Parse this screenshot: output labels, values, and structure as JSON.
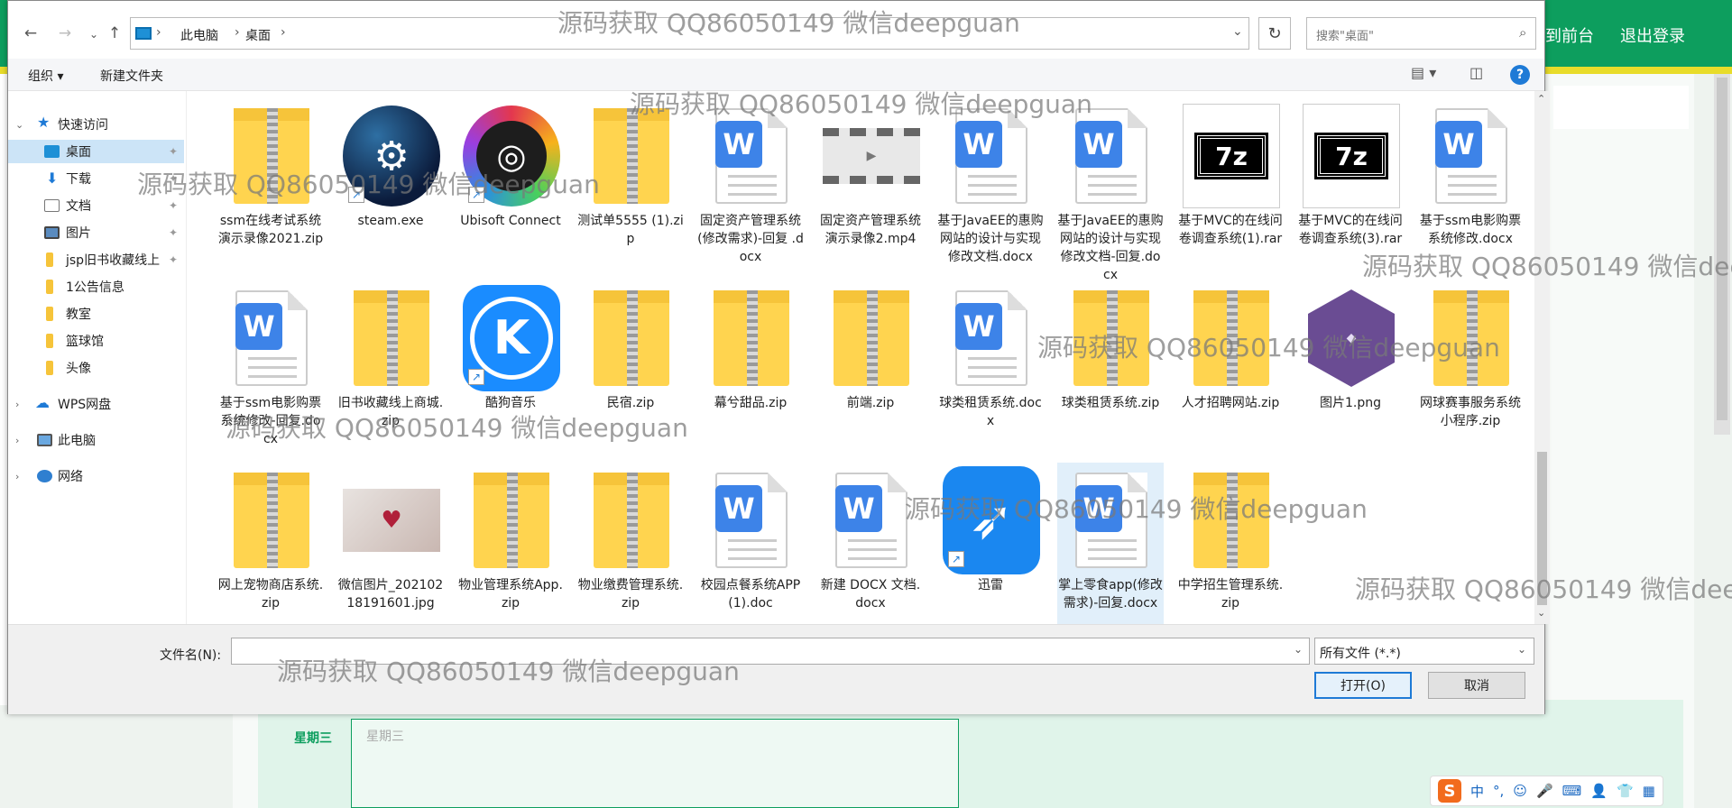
{
  "background": {
    "top_links": [
      "到前台",
      "退出登录"
    ],
    "day_label": "星期三",
    "day_placeholder": "星期三",
    "ime": {
      "logo": "S",
      "items": [
        "中",
        "°,",
        "☺",
        "🎤",
        "⌨",
        "👤",
        "👕",
        "▦"
      ]
    }
  },
  "dialog": {
    "breadcrumb": [
      "此电脑",
      "桌面"
    ],
    "search_placeholder": "搜索\"桌面\"",
    "toolbar": {
      "organize": "组织 ▾",
      "new_folder": "新建文件夹"
    },
    "nav": [
      {
        "label": "快速访问",
        "icon": "star-icon"
      },
      {
        "label": "桌面",
        "icon": "desktop-icon",
        "selected": true,
        "pinned": true
      },
      {
        "label": "下载",
        "icon": "download-icon",
        "pinned": true
      },
      {
        "label": "文档",
        "icon": "document-icon",
        "pinned": true
      },
      {
        "label": "图片",
        "icon": "picture-icon",
        "pinned": true
      },
      {
        "label": "jsp旧书收藏线上",
        "icon": "folder-icon",
        "pinned": true
      },
      {
        "label": "1公告信息",
        "icon": "folder-icon"
      },
      {
        "label": "教室",
        "icon": "folder-icon"
      },
      {
        "label": "篮球馆",
        "icon": "folder-icon"
      },
      {
        "label": "头像",
        "icon": "folder-icon"
      },
      {
        "label": "WPS网盘",
        "icon": "cloud-icon"
      },
      {
        "label": "此电脑",
        "icon": "computer-icon"
      },
      {
        "label": "网络",
        "icon": "network-icon"
      }
    ],
    "files": [
      {
        "name": "ssm在线考试系统演示录像2021.zip",
        "type": "zip"
      },
      {
        "name": "steam.exe",
        "type": "steam"
      },
      {
        "name": "Ubisoft Connect",
        "type": "ubisoft"
      },
      {
        "name": "测试单5555 (1).zip",
        "type": "zip"
      },
      {
        "name": "固定资产管理系统(修改需求)-回复 .docx",
        "type": "docx"
      },
      {
        "name": "固定资产管理系统演示录像2.mp4",
        "type": "video"
      },
      {
        "name": "基于JavaEE的惠购网站的设计与实现修改文档.docx",
        "type": "docx"
      },
      {
        "name": "基于JavaEE的惠购网站的设计与实现修改文档-回复.docx",
        "type": "docx"
      },
      {
        "name": "基于MVC的在线问卷调查系统(1).rar",
        "type": "rar"
      },
      {
        "name": "基于MVC的在线问卷调查系统(3).rar",
        "type": "rar"
      },
      {
        "name": "基于ssm电影购票系统修改.docx",
        "type": "docx"
      },
      {
        "name": "基于ssm电影购票系统修改-回复.docx",
        "type": "docx"
      },
      {
        "name": "旧书收藏线上商城.zip",
        "type": "zip"
      },
      {
        "name": "酷狗音乐",
        "type": "kugou"
      },
      {
        "name": "民宿.zip",
        "type": "zip"
      },
      {
        "name": "幕兮甜品.zip",
        "type": "zip"
      },
      {
        "name": "前端.zip",
        "type": "zip"
      },
      {
        "name": "球类租赁系统.docx",
        "type": "docx"
      },
      {
        "name": "球类租赁系统.zip",
        "type": "zip"
      },
      {
        "name": "人才招聘网站.zip",
        "type": "zip"
      },
      {
        "name": "图片1.png",
        "type": "png"
      },
      {
        "name": "网球赛事服务系统小程序.zip",
        "type": "zip"
      },
      {
        "name": "网上宠物商店系统.zip",
        "type": "zip"
      },
      {
        "name": "微信图片_20210218191601.jpg",
        "type": "jpg"
      },
      {
        "name": "物业管理系统App.zip",
        "type": "zip"
      },
      {
        "name": "物业缴费管理系统.zip",
        "type": "zip"
      },
      {
        "name": "校园点餐系统APP (1).doc",
        "type": "docx"
      },
      {
        "name": "新建 DOCX 文档.docx",
        "type": "docx"
      },
      {
        "name": "迅雷",
        "type": "xunlei"
      },
      {
        "name": "掌上零食app(修改需求)-回复.docx",
        "type": "docx",
        "selected": true
      },
      {
        "name": "中学招生管理系统.zip",
        "type": "zip"
      }
    ],
    "filename_label": "文件名(N):",
    "filename_value": "",
    "filetype": "所有文件 (*.*)",
    "open_button": "打开(O)",
    "cancel_button": "取消"
  },
  "watermark": "源码获取 QQ86050149 微信deepguan"
}
